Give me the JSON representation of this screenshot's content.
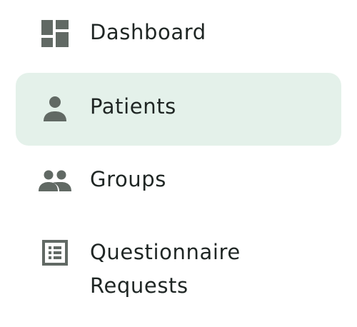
{
  "colors": {
    "active_background": "#e4f1ea",
    "icon": "#616964",
    "text": "#1f2624"
  },
  "nav": {
    "items": [
      {
        "label": "Dashboard",
        "icon": "dashboard-icon",
        "active": false
      },
      {
        "label": "Patients",
        "icon": "person-icon",
        "active": true
      },
      {
        "label": "Groups",
        "icon": "group-icon",
        "active": false
      },
      {
        "label": "Questionnaire\nRequests",
        "icon": "list-alt-icon",
        "active": false
      }
    ]
  }
}
